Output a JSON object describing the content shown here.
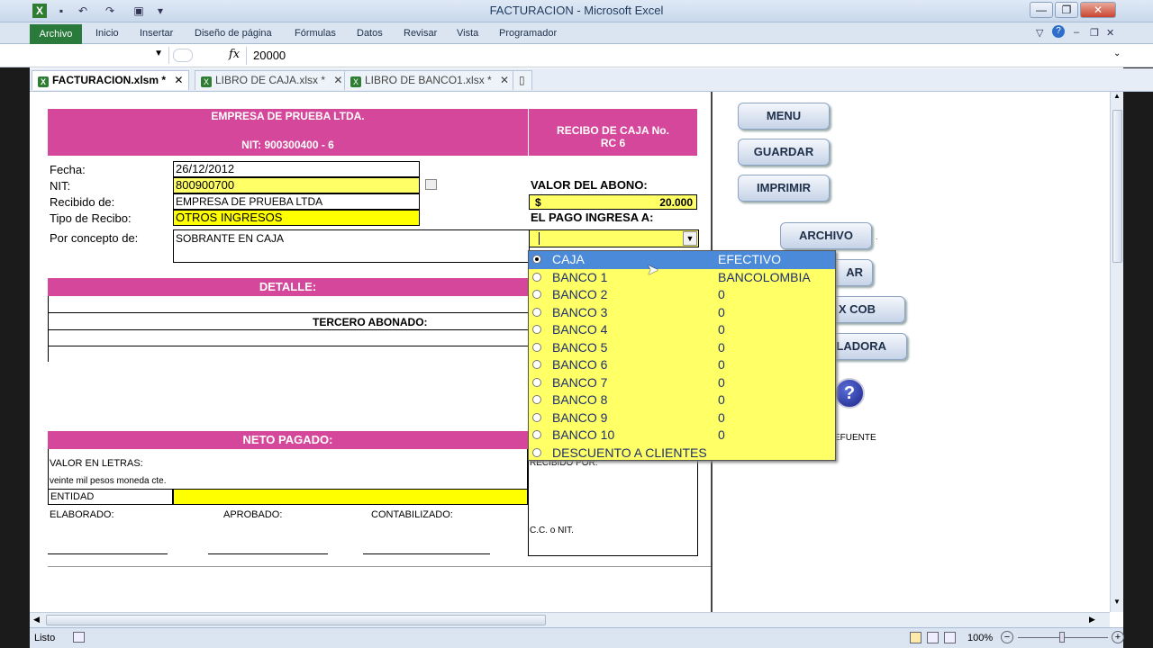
{
  "window": {
    "title": "FACTURACION - Microsoft Excel",
    "min_label": "—",
    "restore_label": "❐",
    "close_label": "✕"
  },
  "qat": {
    "excel_icon": "X",
    "save_icon": "💾",
    "undo_icon": "↶",
    "redo_icon": "↷"
  },
  "ribbon": {
    "tabs": [
      "Archivo",
      "Inicio",
      "Insertar",
      "Diseño de página",
      "Fórmulas",
      "Datos",
      "Revisar",
      "Vista",
      "Programador"
    ]
  },
  "formula_bar": {
    "fx_label": "fx",
    "value": "20000"
  },
  "doc_tabs": [
    {
      "label": "FACTURACION.xlsm *",
      "active": true
    },
    {
      "label": "LIBRO DE CAJA.xlsx *",
      "active": false
    },
    {
      "label": "LIBRO DE BANCO1.xlsx *",
      "active": false
    }
  ],
  "receipt": {
    "company": "EMPRESA DE PRUEBA LTDA.",
    "nit_header": "NIT: 900300400 - 6",
    "receipt_title_line1": "RECIBO DE CAJA  No.",
    "receipt_title_line2": "RC 6",
    "labels": {
      "fecha": "Fecha:",
      "nit": "NIT:",
      "recibido_de": "Recibido de:",
      "tipo_recibo": "Tipo de Recibo:",
      "por_concepto": "Por concepto de:",
      "valor_abono": "VALOR DEL ABONO:",
      "pago_ingresa": "EL PAGO INGRESA A:",
      "detalle": "DETALLE:",
      "tercero_abonado": "TERCERO ABONADO:",
      "neto_pagado": "NETO PAGADO:",
      "valor_letras": "VALOR EN LETRAS:",
      "entidad": "ENTIDAD",
      "elaborado": "ELABORADO:",
      "aprobado": "APROBADO:",
      "contabilizado": "CONTABILIZADO:",
      "recibido_por": "RECIBIDO POR:",
      "cc_nit": "C.C. o NIT."
    },
    "values": {
      "fecha": "26/12/2012",
      "nit": "800900700",
      "recibido_de": "EMPRESA DE PRUEBA LTDA",
      "tipo_recibo": "OTROS INGRESOS",
      "por_concepto": "SOBRANTE EN CAJA",
      "currency": "$",
      "valor_abono": "20.000",
      "valor_letras": "veinte mil pesos moneda cte."
    }
  },
  "buttons": {
    "menu": "MENU",
    "guardar": "GUARDAR",
    "imprimir": "IMPRIMIR",
    "archivo": "ARCHIVO",
    "ar_partial": "AR",
    "xcob_partial": "X COB",
    "uladora_partial": "ULADORA",
    "help": "?",
    "efuente_partial": "EFUENTE"
  },
  "dropdown": {
    "items": [
      {
        "name": "CAJA",
        "detail": "EFECTIVO",
        "selected": true
      },
      {
        "name": "BANCO 1",
        "detail": "BANCOLOMBIA",
        "selected": false
      },
      {
        "name": "BANCO 2",
        "detail": "0",
        "selected": false
      },
      {
        "name": "BANCO 3",
        "detail": "0",
        "selected": false
      },
      {
        "name": "BANCO 4",
        "detail": "0",
        "selected": false
      },
      {
        "name": "BANCO 5",
        "detail": "0",
        "selected": false
      },
      {
        "name": "BANCO 6",
        "detail": "0",
        "selected": false
      },
      {
        "name": "BANCO 7",
        "detail": "0",
        "selected": false
      },
      {
        "name": "BANCO 8",
        "detail": "0",
        "selected": false
      },
      {
        "name": "BANCO 9",
        "detail": "0",
        "selected": false
      },
      {
        "name": "BANCO 10",
        "detail": "0",
        "selected": false
      },
      {
        "name": "DESCUENTO A CLIENTES",
        "detail": "",
        "selected": false
      }
    ]
  },
  "status": {
    "ready": "Listo",
    "zoom": "100%"
  },
  "colors": {
    "band": "#d4479a",
    "field_yellow": "#ffff66",
    "list_selected": "#4a8ad8"
  }
}
